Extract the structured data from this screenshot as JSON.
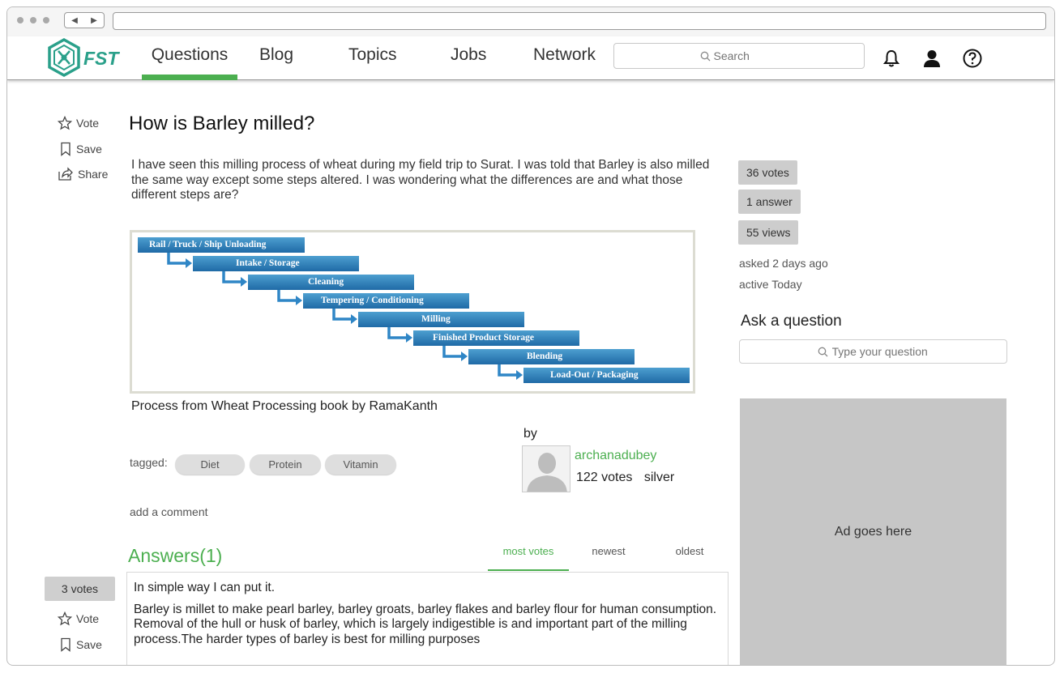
{
  "header": {
    "logo_text": "FST",
    "nav": [
      "Questions",
      "Blog",
      "Topics",
      "Jobs",
      "Network"
    ],
    "active_nav": "Questions",
    "search_placeholder": "Search",
    "icons": [
      "bell-icon",
      "user-icon",
      "help-icon"
    ]
  },
  "question": {
    "actions": {
      "vote": "Vote",
      "save": "Save",
      "share": "Share"
    },
    "title": "How is Barley milled?",
    "body": "I have seen this milling process of wheat during my field trip to Surat. I was told that Barley is also milled the same way except some steps altered. I was wondering what the differences are and what those different steps are?",
    "figure_steps": [
      "Rail / Truck / Ship Unloading",
      "Intake / Storage",
      "Cleaning",
      "Tempering / Conditioning",
      "Milling",
      "Finished Product Storage",
      "Blending",
      "Load-Out / Packaging"
    ],
    "caption": "Process from Wheat Processing book by  RamaKanth",
    "tagged_label": "tagged:",
    "tags": [
      "Diet",
      "Protein",
      "Vitamin"
    ],
    "add_comment": "add a comment",
    "author": {
      "by": "by",
      "username": "archanadubey",
      "votes": "122 votes",
      "badge": "silver"
    }
  },
  "answers": {
    "title": "Answers(1)",
    "sort_tabs": [
      "most votes",
      "newest",
      "oldest"
    ],
    "active_sort": "most votes",
    "items": [
      {
        "votes": "3 votes",
        "vote_label": "Vote",
        "save_label": "Save",
        "intro": "In simple way I can put it.",
        "text": "Barley is millet to make pearl barley, barley groats, barley flakes and barley flour for human consumption. Removal of the hull or husk of barley, which is largely indigestible is and important part of the milling process.The harder types of barley is best for milling purposes"
      }
    ]
  },
  "sidebar": {
    "stats": [
      "36 votes",
      "1 answer",
      "55 views"
    ],
    "asked": "asked 2 days ago",
    "active": "active Today",
    "ask_title": "Ask a question",
    "ask_placeholder": "Type your question",
    "ad_text": "Ad goes here"
  },
  "colors": {
    "accent": "#4caf50",
    "logo": "#2aa08a",
    "stat_bg": "#cdcdcd",
    "ad_bg": "#c6c6c6"
  }
}
